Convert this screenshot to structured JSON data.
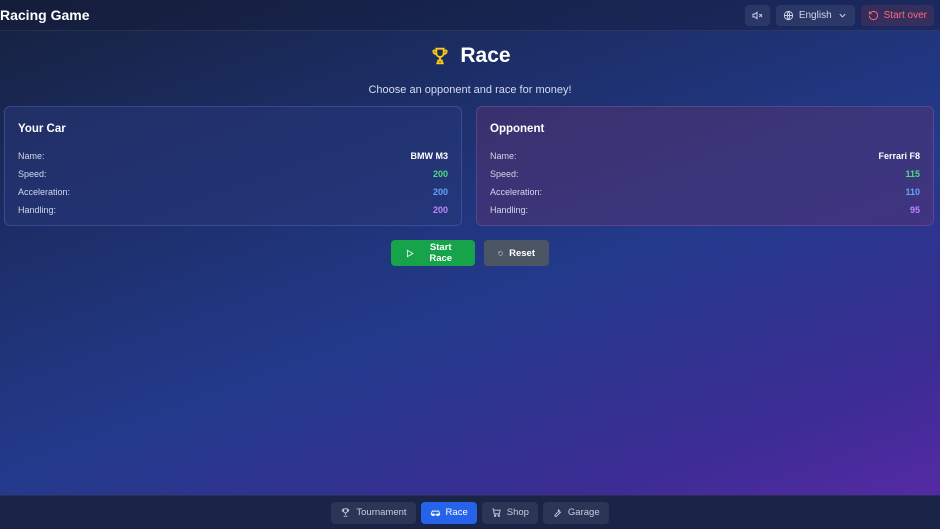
{
  "app": {
    "title": "Racing Game"
  },
  "topbar": {
    "language": "English",
    "start_over": "Start over"
  },
  "race": {
    "title": "Race",
    "subtitle": "Choose an opponent and race for money!"
  },
  "your_car": {
    "heading": "Your Car",
    "labels": {
      "name": "Name:",
      "speed": "Speed:",
      "acceleration": "Acceleration:",
      "handling": "Handling:"
    },
    "values": {
      "name": "BMW M3",
      "speed": "200",
      "acceleration": "200",
      "handling": "200"
    }
  },
  "opponent": {
    "heading": "Opponent",
    "labels": {
      "name": "Name:",
      "speed": "Speed:",
      "acceleration": "Acceleration:",
      "handling": "Handling:"
    },
    "values": {
      "name": "Ferrari F8",
      "speed": "115",
      "acceleration": "110",
      "handling": "95"
    }
  },
  "buttons": {
    "start": "Start Race",
    "reset": "Reset"
  },
  "nav": {
    "tournament": "Tournament",
    "race": "Race",
    "shop": "Shop",
    "garage": "Garage"
  },
  "colors": {
    "accent": "#2563eb",
    "start_button": "#16a34a",
    "speed": "#4ade80",
    "acceleration": "#60a5fa",
    "handling": "#c084fc",
    "danger": "#ff6b7a"
  },
  "icons": {
    "mute": "volume-mute-icon",
    "language": "globe-icon",
    "start_over": "refresh-icon",
    "race": "trophy-icon",
    "start": "play-icon",
    "reset": "reset-icon",
    "tournament": "trophy-icon",
    "race_nav": "car-icon",
    "shop": "cart-icon",
    "garage": "wrench-icon"
  }
}
